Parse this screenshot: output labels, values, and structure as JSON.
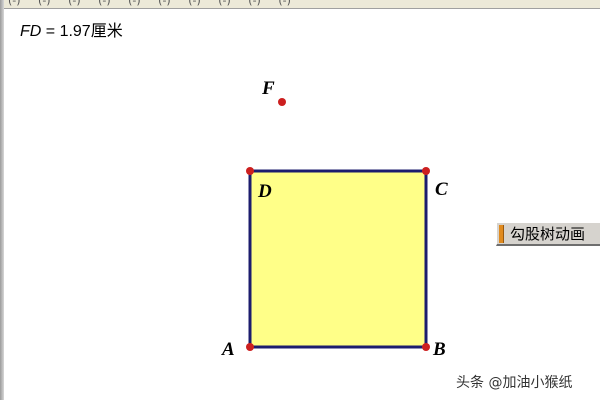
{
  "measurement": {
    "var": "FD",
    "rest": " = 1.97厘米"
  },
  "points": {
    "F": "F",
    "D": "D",
    "C": "C",
    "A": "A",
    "B": "B"
  },
  "animate_button": {
    "label": "勾股树动画"
  },
  "watermark": "头条 @加油小猴纸",
  "colors": {
    "square_fill": "#ffff88",
    "square_stroke": "#1c1c6e",
    "point": "#cc1f1f",
    "button_handle": "#e08a1e"
  }
}
